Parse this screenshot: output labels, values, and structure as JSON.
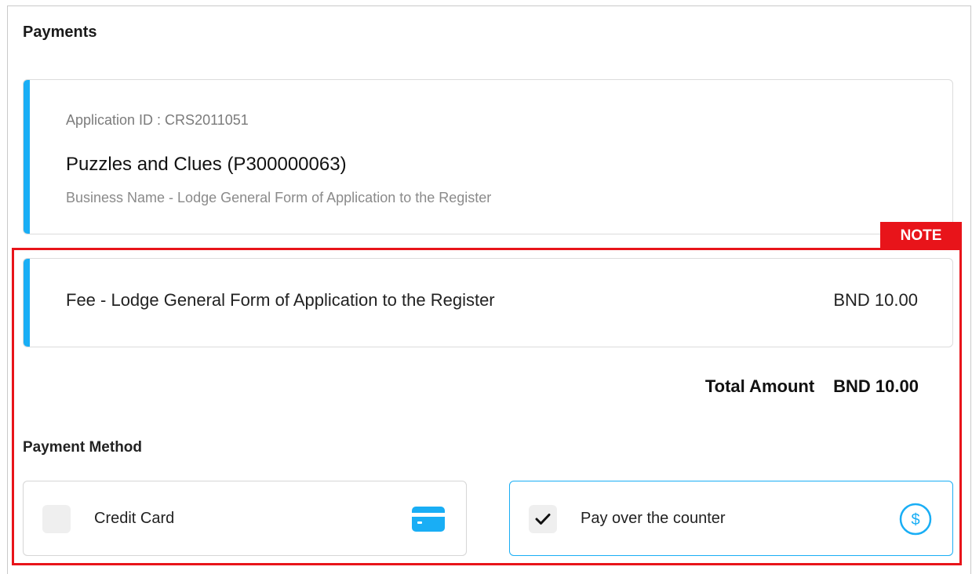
{
  "section": {
    "title": "Payments"
  },
  "application": {
    "id_text": "Application ID : CRS2011051",
    "name": "Puzzles and Clues (P300000063)",
    "description": "Business Name - Lodge General Form of Application to the Register"
  },
  "annotation": {
    "note_label": "NOTE",
    "color": "#e8141a"
  },
  "fee": {
    "label": "Fee - Lodge General Form of Application to the Register",
    "amount": "BND 10.00"
  },
  "total": {
    "label": "Total Amount",
    "amount": "BND 10.00"
  },
  "payment_method": {
    "title": "Payment Method",
    "options": [
      {
        "label": "Credit Card",
        "selected": false,
        "icon": "credit-card-icon"
      },
      {
        "label": "Pay over the counter",
        "selected": true,
        "icon": "dollar-circle-icon"
      }
    ]
  },
  "colors": {
    "accent": "#19aef5",
    "selected_border": "#19aef5"
  }
}
